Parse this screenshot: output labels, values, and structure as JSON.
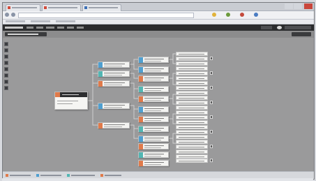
{
  "window": {
    "tabs": [
      {
        "title": "",
        "icon": "page-icon",
        "color": "#d24a3a"
      },
      {
        "title": "",
        "icon": "page-icon",
        "color": "#d24a3a"
      },
      {
        "title": "",
        "icon": "page-icon",
        "color": "#3b6fb6"
      }
    ],
    "address": "",
    "window_controls": [
      "minimize-icon",
      "maximize-icon",
      "close-icon"
    ]
  },
  "app": {
    "brand": "",
    "menu": [
      "",
      "",
      "",
      "",
      "",
      ""
    ],
    "user": "",
    "canvas_title": "",
    "canvas_action": "",
    "tools": [
      "select-icon",
      "move-icon",
      "zoom-icon",
      "link-icon",
      "node-icon",
      "shape-icon",
      "text-icon",
      "delete-icon"
    ]
  },
  "colors": {
    "orange": "#e07a4a",
    "blue": "#4f9fd0",
    "teal": "#52b6b3",
    "dark": "#2d2e30",
    "canvas": "#9a9a9b"
  },
  "tree": {
    "root": {
      "title": "",
      "badge": "orange"
    },
    "level1": [
      {
        "label": "",
        "badge": "blue"
      },
      {
        "label": "",
        "badge": "teal"
      },
      {
        "label": "",
        "badge": "orange"
      },
      {
        "label": "",
        "badge": "blue"
      },
      {
        "label": "",
        "badge": "orange"
      }
    ],
    "level2": [
      {
        "label": "",
        "badge": "blue"
      },
      {
        "label": "",
        "badge": "blue"
      },
      {
        "label": "",
        "badge": "orange"
      },
      {
        "label": "",
        "badge": "teal"
      },
      {
        "label": "",
        "badge": "orange"
      },
      {
        "label": "",
        "badge": "blue"
      },
      {
        "label": "",
        "badge": "orange"
      },
      {
        "label": "",
        "badge": "teal"
      },
      {
        "label": "",
        "badge": "blue"
      },
      {
        "label": "",
        "badge": "orange"
      },
      {
        "label": "",
        "badge": "teal"
      },
      {
        "label": "",
        "badge": "orange"
      }
    ],
    "leaves": [
      "",
      "",
      "",
      "",
      "",
      "",
      "",
      "",
      "",
      "",
      "",
      "",
      "",
      "",
      "",
      "",
      "",
      "",
      "",
      "",
      "",
      "",
      "",
      "",
      "",
      ""
    ]
  },
  "legend": [
    {
      "label": "",
      "color": "#e07a4a"
    },
    {
      "label": "",
      "color": "#4f9fd0"
    },
    {
      "label": "",
      "color": "#52b6b3"
    },
    {
      "label": "",
      "color": "#e07a4a"
    }
  ]
}
